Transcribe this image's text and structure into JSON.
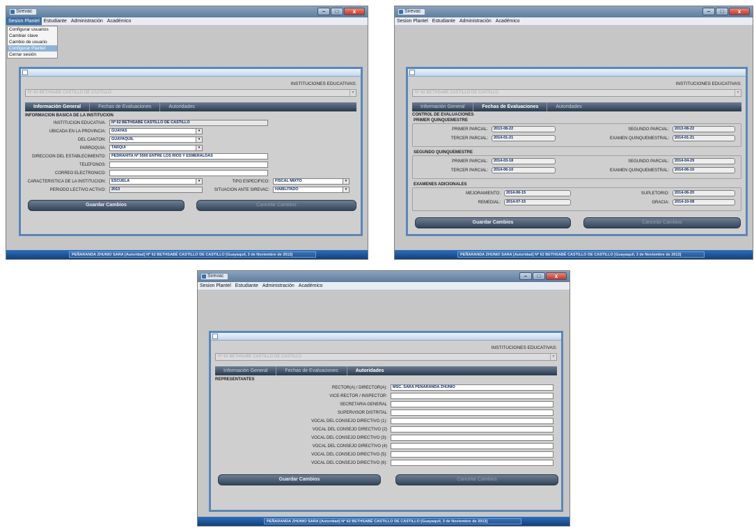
{
  "window": {
    "title": "Sirevac",
    "minimize": "–",
    "maximize": "□",
    "close": "x"
  },
  "menu": {
    "sesion": "Sesion Plantel",
    "estudiante": "Estudiante",
    "administracion": "Administración",
    "academico": "Académico"
  },
  "dropdown": [
    "Configurar usuarios",
    "Cambiar clave",
    "Cambio de usuario",
    "Configurar Plantel",
    "Cerrar sesión"
  ],
  "institution": {
    "label": "INSTITUCIONES EDUCATIVAS:",
    "value": "Nº 62 BETHSABÉ CASTILLO DE CASTILLO"
  },
  "tabs": {
    "general": "Información General",
    "fechas": "Fechas de Evaluaciones",
    "autoridades": "Autoridades"
  },
  "general": {
    "section": "INFORMACION BASICA DE LA INSTITUCION",
    "institucion_label": "INSTITUCION EDUCATIVA:",
    "institucion_value": "Nº 62 BETHSABÉ CASTILLO DE CASTILLO",
    "provincia_label": "UBICADA EN LA PROVINCIA:",
    "provincia_value": "GUAYAS",
    "canton_label": "DEL CANTON:",
    "canton_value": "GUAYAQUIL",
    "parroquia_label": "PARROQUIA:",
    "parroquia_value": "TARQUI",
    "direccion_label": "DIRECCION DEL ESTABLECIMIENTO:",
    "direccion_value": "PEDRAHITA Nº 5500 ENTRE LOS RIOS Y ESMERALDAS",
    "telefonos_label": "TELEFONOS:",
    "telefonos_value": "",
    "correo_label": "CORREO ELECTRONICO:",
    "correo_value": "",
    "caracteristica_label": "CARACTERISTICA DE LA INSTITUCION:",
    "caracteristica_value": "ESCUELA",
    "tipo_label": "TIPO ESPECIFICO:",
    "tipo_value": "FISCAL MIXTO",
    "periodo_label": "PERIODO LECTIVO ACTIVO:",
    "periodo_value": "2013",
    "situacion_label": "SITUACION ANTE SIREVAC:",
    "situacion_value": "HABILITADO"
  },
  "fechas": {
    "section": "CONTROL DE EVALUACIONES",
    "q1_title": "PRIMER QUINQUEMESTRE",
    "q2_title": "SEGUNDO QUINQUEMESTRE",
    "extra_title": "EXAMENES ADICIONALES",
    "primer_parcial": "PRIMER PARCIAL:",
    "segundo_parcial": "SEGUNDO PARCIAL:",
    "tercer_parcial": "TERCER PARCIAL:",
    "examen_quinq": "EXAMEN QUINQUEMESTRAL:",
    "q1_primer": "2013-08-22",
    "q1_segundo": "2013-08-22",
    "q1_tercer": "2014-01-21",
    "q1_examen": "2014-01-21",
    "q2_primer": "2014-03-18",
    "q2_segundo": "2014-04-29",
    "q2_tercer": "2014-06-10",
    "q2_examen": "2014-06-10",
    "mejoramiento_label": "MEJORAMIENTO:",
    "mejoramiento_value": "2014-06-15",
    "supletorio_label": "SUPLETORIO:",
    "supletorio_value": "2014-06-20",
    "remedial_label": "REMEDIAL:",
    "remedial_value": "2014-07-15",
    "gracia_label": "GRACIA:",
    "gracia_value": "2014-10-08"
  },
  "autoridades": {
    "section": "REPRESENTANTES",
    "rows": [
      {
        "label": "RECTOR(A) / DIRECTOR(A):",
        "value": "MSC. SARA PEÑARANDA ZHUNIO"
      },
      {
        "label": "VICE-RECTOR / INSPECTOR:",
        "value": ""
      },
      {
        "label": "SECRETARIA GENERAL",
        "value": ""
      },
      {
        "label": "SUPERVISOR DISTRITAL",
        "value": ""
      },
      {
        "label": "VOCAL DEL CONSEJO DIRECTIVO (1):",
        "value": ""
      },
      {
        "label": "VOCAL DEL CONSEJO DIRECTIVO (2)",
        "value": ""
      },
      {
        "label": "VOCAL DEL CONSEJO DIRECTIVO (3):",
        "value": ""
      },
      {
        "label": "VOCAL DEL CONSEJO DIRECTIVO (4)",
        "value": ""
      },
      {
        "label": "VOCAL DEL CONSEJO DIRECTIVO (5):",
        "value": ""
      },
      {
        "label": "VOCAL DEL CONSEJO DIRECTIVO (6):",
        "value": ""
      }
    ]
  },
  "buttons": {
    "guardar": "Guardar Cambios",
    "cancelar": "Cancelar Cambios"
  },
  "status": "PEÑARANDA ZHUNIO SARA [Autoridad]  Nº 62 BETHSABÉ CASTILLO DE CASTILLO [Guayaquil, 3 de Noviembre de 2013]",
  "colors": {
    "accent": "#5a86b8",
    "tab_bar": "#2a3a4e",
    "status_bar": "#1c56a0"
  }
}
